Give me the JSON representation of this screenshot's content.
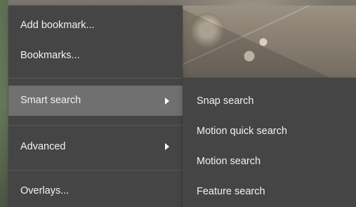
{
  "menu": {
    "items": [
      {
        "label": "Add bookmark..."
      },
      {
        "label": "Bookmarks..."
      },
      {
        "label": "Smart search"
      },
      {
        "label": "Advanced"
      },
      {
        "label": "Overlays..."
      }
    ]
  },
  "submenu": {
    "items": [
      {
        "label": "Snap search"
      },
      {
        "label": "Motion quick search"
      },
      {
        "label": "Motion search"
      },
      {
        "label": "Feature search"
      }
    ]
  },
  "colors": {
    "menu_background": "#454545",
    "selected_background": "#707070",
    "text": "#f2f2f2"
  },
  "icons": {
    "submenu_arrow": "chevron-right-icon"
  }
}
